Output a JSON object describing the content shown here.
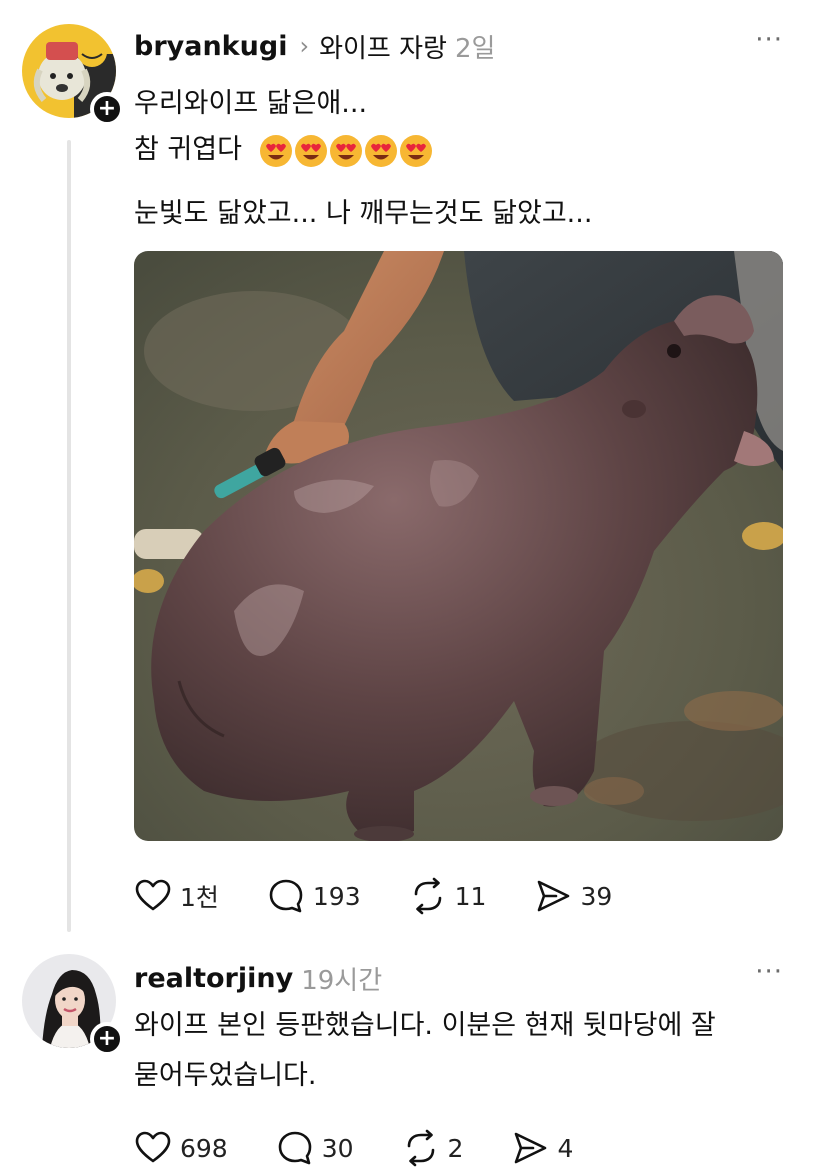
{
  "posts": [
    {
      "username": "bryankugi",
      "topic": "와이프 자랑",
      "time": "2일",
      "lines": [
        "우리와이프 닮은애...",
        "참 귀엽다",
        "눈빛도 닮았고... 나 깨무는것도 닮았고..."
      ],
      "emoji": [
        "heart-eyes-emoji",
        "heart-eyes-emoji",
        "heart-eyes-emoji",
        "heart-eyes-emoji",
        "heart-eyes-emoji"
      ],
      "actions": {
        "likes": "1천",
        "comments": "193",
        "reposts": "11",
        "shares": "39"
      }
    },
    {
      "username": "realtorjiny",
      "time": "19시간",
      "lines": [
        "와이프 본인 등판했습니다. 이분은 현재 뒷마당에 잘",
        "묻어두었습니다."
      ],
      "actions": {
        "likes": "698",
        "comments": "30",
        "reposts": "2",
        "shares": "4"
      }
    }
  ],
  "ui": {
    "follow_symbol": "+",
    "more_symbol": "···",
    "chevron_symbol": "›"
  },
  "icons": {
    "like": "heart-icon",
    "comment": "comment-bubble-icon",
    "repost": "repost-icon",
    "share": "send-icon",
    "more": "more-horizontal-icon",
    "follow": "plus-icon"
  }
}
